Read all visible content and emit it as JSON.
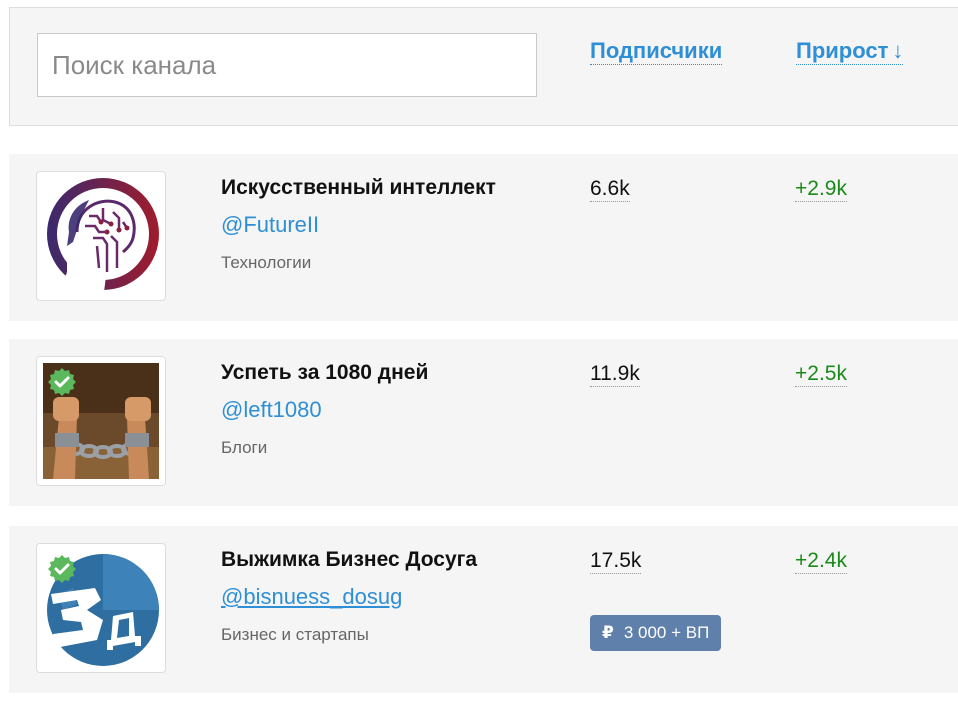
{
  "search": {
    "placeholder": "Поиск канала"
  },
  "sort": {
    "subscribers_label": "Подписчики",
    "growth_label": "Прирост",
    "growth_arrow": "↓"
  },
  "colors": {
    "link": "#2f8fd6",
    "growth": "#1a8a1a",
    "badge": "#5f80aa",
    "verified": "#5cb85c"
  },
  "channels": [
    {
      "title": "Искусственный интеллект",
      "handle": "@FutureII",
      "category": "Технологии",
      "subscribers": "6.6k",
      "growth": "+2.9k",
      "verified": false,
      "avatar_icon": "ai-brain-head-icon"
    },
    {
      "title": "Успеть за 1080 дней",
      "handle": "@left1080",
      "category": "Блоги",
      "subscribers": "11.9k",
      "growth": "+2.5k",
      "verified": true,
      "avatar_icon": "broken-chains-fists-icon"
    },
    {
      "title": "Выжимка Бизнес Досуга",
      "handle": "@bisnuess_dosug",
      "category": "Бизнес и стартапы",
      "subscribers": "17.5k",
      "growth": "+2.4k",
      "verified": true,
      "avatar_icon": "bd-logo-icon",
      "price": {
        "currency_symbol": "₽",
        "label": "3 000 + ВП"
      }
    }
  ]
}
